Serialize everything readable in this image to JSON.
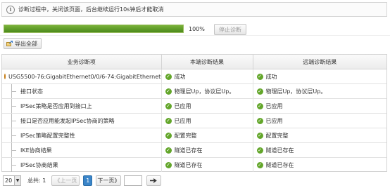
{
  "notice": {
    "icon": "info-icon",
    "text": "诊断过程中，关闭该页面，后台继续运行10s钟后才能取消"
  },
  "progress": {
    "percent": 100,
    "label": "100%",
    "stop_label": "停止诊断",
    "color": "#5b9a25"
  },
  "toolbar": {
    "export_label": "导出全部",
    "export_icon": "export-icon"
  },
  "table": {
    "headers": [
      "业务诊断项",
      "本端诊断结果",
      "远端诊断结果"
    ],
    "parent": {
      "name": "USG5500-76:GigabitEthernet0/0/6-74:GigabitEthernet0/...",
      "local": "成功",
      "remote": "成功"
    },
    "rows": [
      {
        "item": "接口状态",
        "local": "物理层Up，协议层Up。",
        "remote": "物理层Up，协议层Up。"
      },
      {
        "item": "IPSec策略是否应用到接口上",
        "local": "已应用",
        "remote": "已应用"
      },
      {
        "item": "接口是否应用能发起IPSec协商的策略",
        "local": "已应用",
        "remote": "已应用"
      },
      {
        "item": "IPSec策略配置完整性",
        "local": "配置完整",
        "remote": "配置完整"
      },
      {
        "item": "IKE协商结果",
        "local": "隧道已存在",
        "remote": "隧道已存在"
      },
      {
        "item": "IPSec协商结果",
        "local": "隧道已存在",
        "remote": "隧道已存在"
      }
    ],
    "ok_icon": "check-circle-icon",
    "ok_color": "#63a62a"
  },
  "pager": {
    "page_size": "20",
    "total_text": "总共: 1",
    "prev_label": "《上一页",
    "current_page": "1",
    "next_label": "下一页》",
    "go_icon": "arrow-right-icon"
  }
}
